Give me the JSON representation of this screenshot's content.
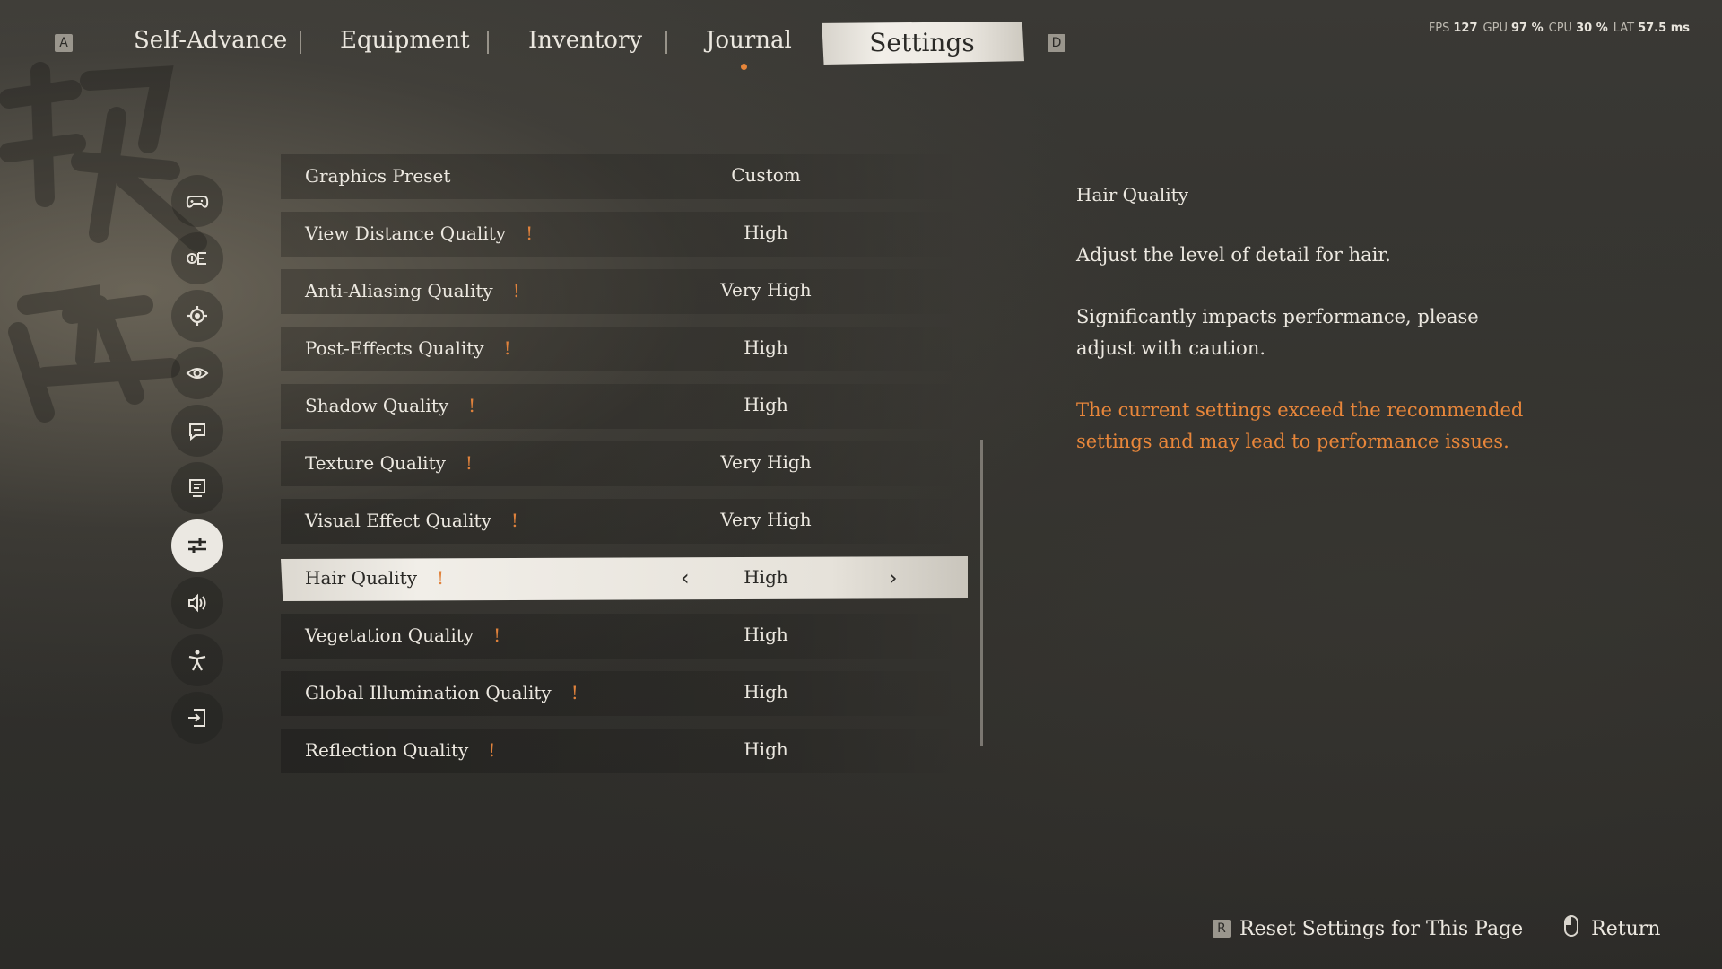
{
  "top_nav": {
    "left_key": "A",
    "right_key": "D",
    "tabs": [
      {
        "label": "Self-Advance"
      },
      {
        "label": "Equipment"
      },
      {
        "label": "Inventory"
      },
      {
        "label": "Journal"
      },
      {
        "label": "Settings"
      }
    ],
    "active_tab": "Settings"
  },
  "perf": {
    "fps_label": "FPS",
    "fps": "127",
    "gpu_label": "GPU",
    "gpu": "97",
    "cpu_label": "CPU",
    "cpu": "30",
    "lat_label": "LAT",
    "lat": "57.5",
    "pct": "%",
    "ms": "ms"
  },
  "sidebar": {
    "icons": [
      "gamepad-icon",
      "keybind-icon",
      "gear-icon",
      "eye-icon",
      "chat-icon",
      "monitor-icon",
      "sliders-icon",
      "speaker-icon",
      "accessibility-icon",
      "exit-icon"
    ],
    "active_index": 6
  },
  "settings": [
    {
      "label": "Graphics Preset",
      "value": "Custom",
      "warn": ""
    },
    {
      "label": "View Distance Quality",
      "value": "High",
      "warn": "!"
    },
    {
      "label": "Anti-Aliasing Quality",
      "value": "Very High",
      "warn": "!"
    },
    {
      "label": "Post-Effects Quality",
      "value": "High",
      "warn": "!"
    },
    {
      "label": "Shadow Quality",
      "value": "High",
      "warn": "!"
    },
    {
      "label": "Texture Quality",
      "value": "Very High",
      "warn": "!"
    },
    {
      "label": "Visual Effect Quality",
      "value": "Very High",
      "warn": "!"
    },
    {
      "label": "Hair Quality",
      "value": "High",
      "warn": "!"
    },
    {
      "label": "Vegetation Quality",
      "value": "High",
      "warn": "!"
    },
    {
      "label": "Global Illumination Quality",
      "value": "High",
      "warn": "!"
    },
    {
      "label": "Reflection Quality",
      "value": "High",
      "warn": "!"
    }
  ],
  "selected_index": 7,
  "arrows": {
    "left": "‹",
    "right": "›"
  },
  "description": {
    "title": "Hair Quality",
    "text": "Adjust the level of detail for hair.",
    "performance": "Significantly impacts performance, please adjust with caution.",
    "warning": "The current settings exceed the recommended settings and may lead to performance issues."
  },
  "footer": {
    "reset_key": "R",
    "reset_label": "Reset Settings for This Page",
    "return_label": "Return"
  },
  "colors": {
    "accent": "#e8863a",
    "selected_bg": "#ece8e1"
  }
}
